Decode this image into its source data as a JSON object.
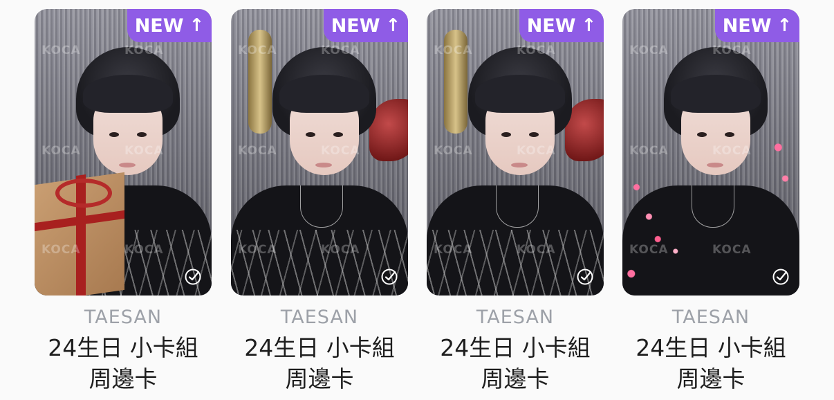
{
  "cards": [
    {
      "badge": "NEW",
      "watermark": "KOCA",
      "artist": "TAESAN",
      "title": "24生日 小卡組",
      "category": "周邊卡",
      "variant": "gift"
    },
    {
      "badge": "NEW",
      "watermark": "KOCA",
      "artist": "TAESAN",
      "title": "24生日 小卡組",
      "category": "周邊卡",
      "variant": "balloon"
    },
    {
      "badge": "NEW",
      "watermark": "KOCA",
      "artist": "TAESAN",
      "title": "24生日 小卡組",
      "category": "周邊卡",
      "variant": "balloon"
    },
    {
      "badge": "NEW",
      "watermark": "KOCA",
      "artist": "TAESAN",
      "title": "24生日 小卡組",
      "category": "周邊卡",
      "variant": "lights"
    }
  ],
  "colors": {
    "badge": "#8f5ce6",
    "artist": "#9da1a8",
    "title": "#1e1e1e"
  },
  "icons": {
    "badge_arrow": "arrow-up-icon",
    "select": "check-circle-icon"
  }
}
